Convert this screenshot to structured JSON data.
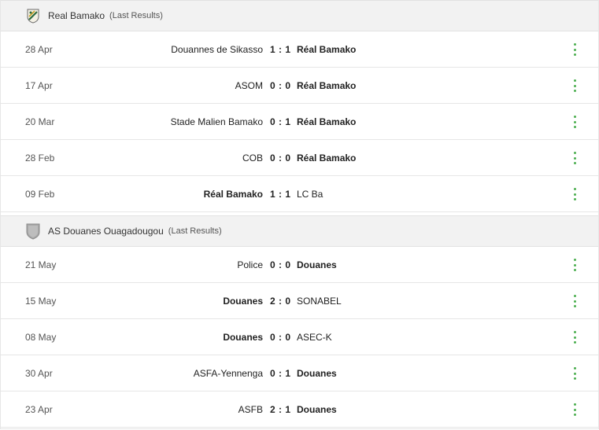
{
  "sections": [
    {
      "team": "Real Bamako",
      "subtitle": "(Last Results)",
      "logo_icon": "real-bamako-crest",
      "matches": [
        {
          "date": "28 Apr",
          "home": "Douannes de Sikasso",
          "score": "1 : 1",
          "away": "Réal Bamako",
          "bold": "away"
        },
        {
          "date": "17 Apr",
          "home": "ASOM",
          "score": "0 : 0",
          "away": "Réal Bamako",
          "bold": "away"
        },
        {
          "date": "20 Mar",
          "home": "Stade Malien Bamako",
          "score": "0 : 1",
          "away": "Réal Bamako",
          "bold": "away"
        },
        {
          "date": "28 Feb",
          "home": "COB",
          "score": "0 : 0",
          "away": "Réal Bamako",
          "bold": "away"
        },
        {
          "date": "09 Feb",
          "home": "Réal Bamako",
          "score": "1 : 1",
          "away": "LC Ba",
          "bold": "home"
        }
      ]
    },
    {
      "team": "AS Douanes Ouagadougou",
      "subtitle": "(Last Results)",
      "logo_icon": "shield-icon",
      "matches": [
        {
          "date": "21 May",
          "home": "Police",
          "score": "0 : 0",
          "away": "Douanes",
          "bold": "away"
        },
        {
          "date": "15 May",
          "home": "Douanes",
          "score": "2 : 0",
          "away": "SONABEL",
          "bold": "home"
        },
        {
          "date": "08 May",
          "home": "Douanes",
          "score": "0 : 0",
          "away": "ASEC-K",
          "bold": "home"
        },
        {
          "date": "30 Apr",
          "home": "ASFA-Yennenga",
          "score": "0 : 1",
          "away": "Douanes",
          "bold": "away"
        },
        {
          "date": "23 Apr",
          "home": "ASFB",
          "score": "2 : 1",
          "away": "Douanes",
          "bold": "away"
        }
      ]
    }
  ],
  "colors": {
    "menu_dots": "#4caf50",
    "header_bg": "#f2f2f2"
  }
}
